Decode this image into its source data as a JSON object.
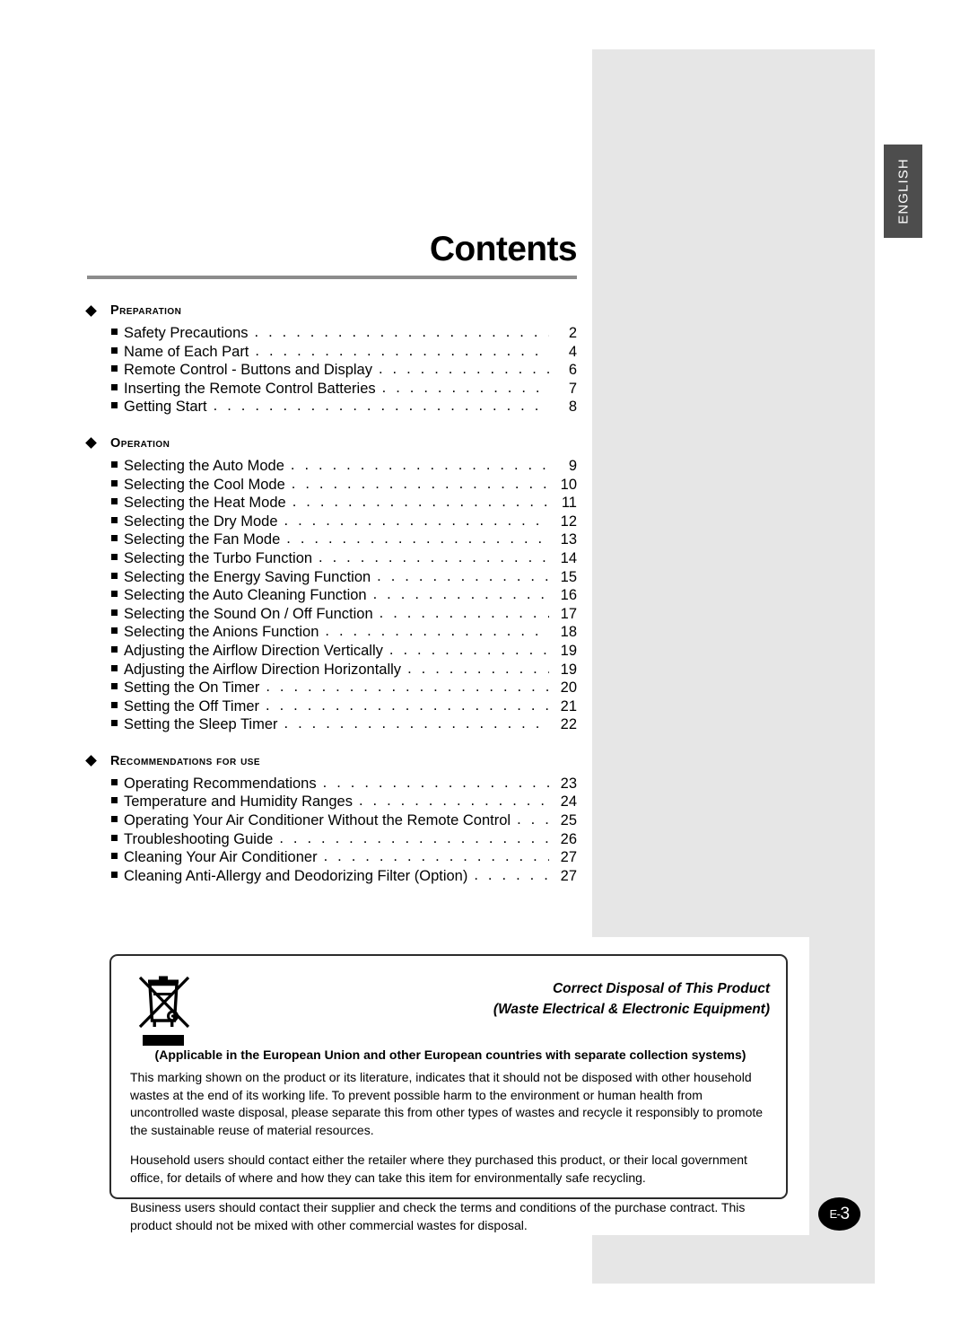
{
  "page": {
    "title": "Contents",
    "language_tab": "ENGLISH",
    "page_badge_prefix": "E-",
    "page_badge_number": "3",
    "accent_rule_color": "#8c8c8c",
    "panel_color": "#e6e6e6",
    "tab_color": "#4d4d4d"
  },
  "toc": {
    "leader_dots": ". . . . . . . . . . . . . . . . . . . . . . . . . . . . . . . . . . . . . . . . . . . . . . . . . . . . . . . . . . . . . .",
    "sections": [
      {
        "heading": "Preparation",
        "entries": [
          {
            "label": "Safety Precautions",
            "page": "2"
          },
          {
            "label": "Name of Each Part",
            "page": "4"
          },
          {
            "label": "Remote Control - Buttons and Display",
            "page": "6"
          },
          {
            "label": "Inserting the Remote Control Batteries",
            "page": "7"
          },
          {
            "label": "Getting Start",
            "page": "8"
          }
        ]
      },
      {
        "heading": "Operation",
        "entries": [
          {
            "label": "Selecting the Auto Mode",
            "page": "9"
          },
          {
            "label": "Selecting the Cool Mode",
            "page": "10"
          },
          {
            "label": "Selecting the Heat Mode",
            "page": "11"
          },
          {
            "label": "Selecting the Dry Mode",
            "page": "12"
          },
          {
            "label": "Selecting the Fan Mode",
            "page": "13"
          },
          {
            "label": "Selecting the Turbo Function",
            "page": "14"
          },
          {
            "label": "Selecting the Energy Saving Function",
            "page": "15"
          },
          {
            "label": "Selecting the Auto Cleaning Function",
            "page": "16"
          },
          {
            "label": "Selecting the Sound On / Off Function",
            "page": "17"
          },
          {
            "label": "Selecting the Anions Function",
            "page": "18"
          },
          {
            "label": "Adjusting the Airflow Direction Vertically",
            "page": "19"
          },
          {
            "label": "Adjusting the Airflow Direction Horizontally",
            "page": "19"
          },
          {
            "label": "Setting the On Timer",
            "page": "20"
          },
          {
            "label": "Setting the Off Timer",
            "page": "21"
          },
          {
            "label": "Setting the Sleep Timer",
            "page": "22"
          }
        ]
      },
      {
        "heading": "Recommendations for use",
        "entries": [
          {
            "label": "Operating Recommendations",
            "page": "23"
          },
          {
            "label": "Temperature and Humidity Ranges",
            "page": "24"
          },
          {
            "label": "Operating Your Air Conditioner Without the Remote Control",
            "page": "25"
          },
          {
            "label": "Troubleshooting Guide",
            "page": "26"
          },
          {
            "label": "Cleaning Your Air Conditioner",
            "page": "27"
          },
          {
            "label": "Cleaning Anti-Allergy and Deodorizing Filter (Option)",
            "page": "27"
          }
        ]
      }
    ]
  },
  "disposal_notice": {
    "icon_name": "crossed-out-wheeled-bin-icon",
    "heading_line1": "Correct Disposal of This Product",
    "heading_line2": "(Waste Electrical & Electronic Equipment)",
    "applicability": "(Applicable in the European Union and other European countries with separate collection systems)",
    "paragraphs": [
      "This marking shown on the product or its literature, indicates that it should not be disposed with other household wastes at the end of its working life. To prevent possible harm to the environment or human health from uncontrolled waste disposal, please separate this from other types of wastes and recycle it responsibly to promote the sustainable reuse of material resources.",
      "Household users should contact either the retailer where they purchased this product, or their local government office, for details of where and how they can take this item for environmentally safe recycling.",
      "Business users should contact their supplier and check the terms and conditions of the purchase contract. This product should not be mixed with other commercial wastes for disposal."
    ]
  }
}
